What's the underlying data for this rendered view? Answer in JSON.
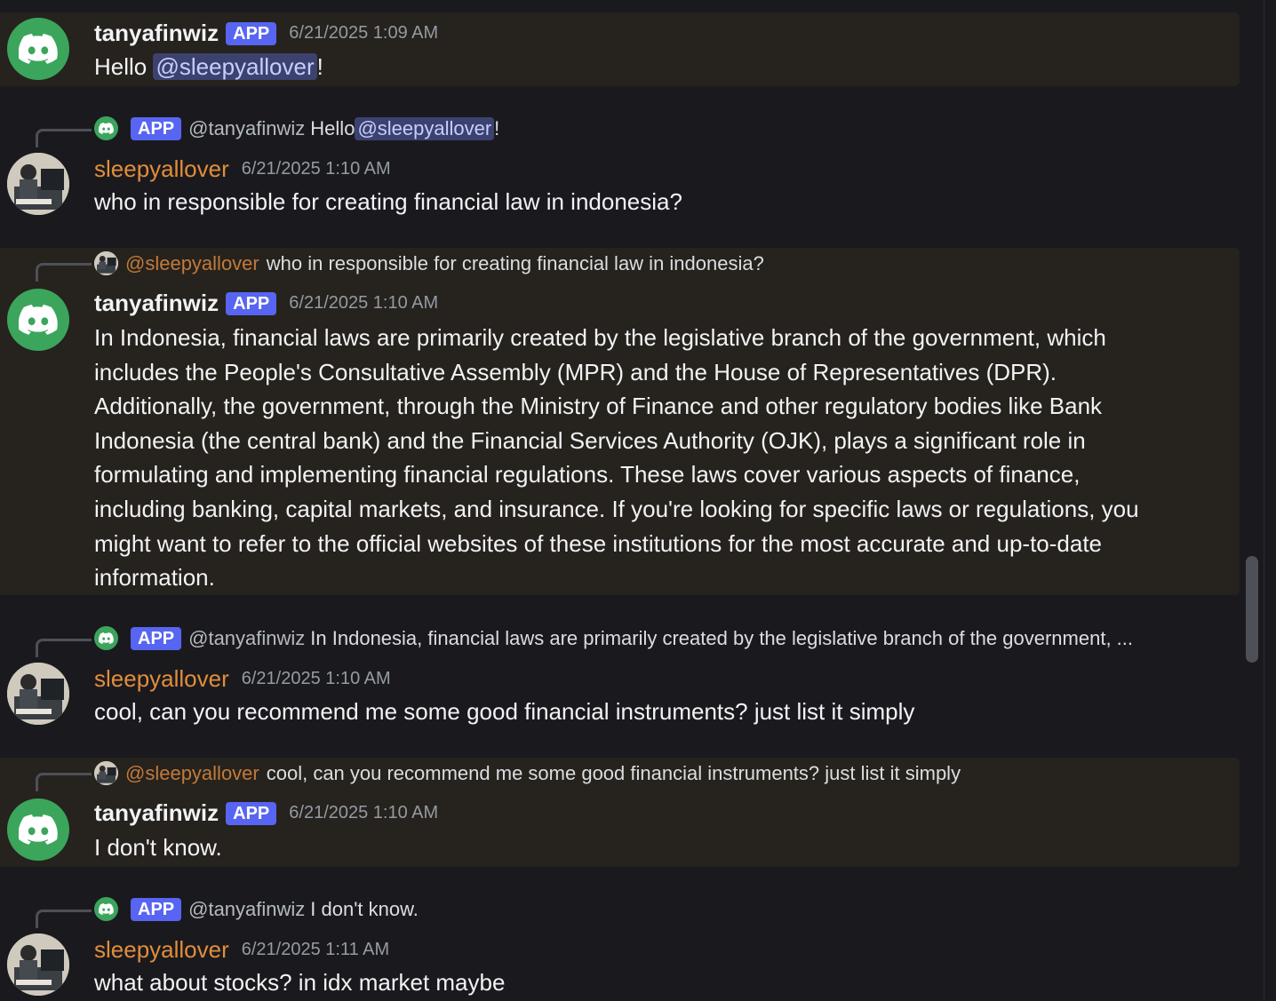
{
  "messages": [
    {
      "author": "tanyafinwiz",
      "badge": "APP",
      "timestamp": "6/21/2025 1:09 AM",
      "text_before": "Hello ",
      "mention": "@sleepyallover",
      "text_after": "!"
    },
    {
      "reply": {
        "badge": "APP",
        "author": "@tanyafinwiz",
        "text_before": "Hello ",
        "mention": "@sleepyallover",
        "text_after": "!"
      },
      "author": "sleepyallover",
      "timestamp": "6/21/2025 1:10 AM",
      "text": "who in responsible for creating financial law in indonesia?"
    },
    {
      "reply": {
        "author": "@sleepyallover",
        "text": "who in responsible for creating financial law in indonesia?"
      },
      "author": "tanyafinwiz",
      "badge": "APP",
      "timestamp": "6/21/2025 1:10 AM",
      "lines": [
        "In Indonesia, financial laws are primarily created by the legislative branch of the government, which",
        "includes the People's Consultative Assembly (MPR) and the House of Representatives (DPR).",
        "Additionally, the government, through the Ministry of Finance and other regulatory bodies like Bank",
        "Indonesia (the central bank) and the Financial Services Authority (OJK), plays a significant role in",
        "formulating and implementing financial regulations. These laws cover various aspects of finance,",
        "including banking, capital markets, and insurance. If you're looking for specific laws or regulations, you",
        "might want to refer to the official websites of these institutions for the most accurate and up-to-date",
        "information."
      ]
    },
    {
      "reply": {
        "badge": "APP",
        "author": "@tanyafinwiz",
        "text": "In Indonesia, financial laws are primarily created by the legislative branch of the government, ..."
      },
      "author": "sleepyallover",
      "timestamp": "6/21/2025 1:10 AM",
      "text": "cool, can you recommend me some good financial instruments? just list it simply"
    },
    {
      "reply": {
        "author": "@sleepyallover",
        "text": "cool, can you recommend me some good financial instruments? just list it simply"
      },
      "author": "tanyafinwiz",
      "badge": "APP",
      "timestamp": "6/21/2025 1:10 AM",
      "text": "I don't know."
    },
    {
      "reply": {
        "badge": "APP",
        "author": "@tanyafinwiz",
        "text": "I don't know."
      },
      "author": "sleepyallover",
      "timestamp": "6/21/2025 1:11 AM",
      "text": "what about stocks? in idx market maybe"
    }
  ],
  "icons": {
    "bot_avatar": "discord-logo-icon",
    "user_avatar": "user-photo-avatar"
  },
  "colors": {
    "background": "#1a1a1e",
    "highlight": "#26221d",
    "app_badge": "#5865f2",
    "bot_avatar": "#3ba55c",
    "user_name": "#e28d3c",
    "mention_bg": "#3c4270",
    "mention_text": "#c9cdfb"
  }
}
